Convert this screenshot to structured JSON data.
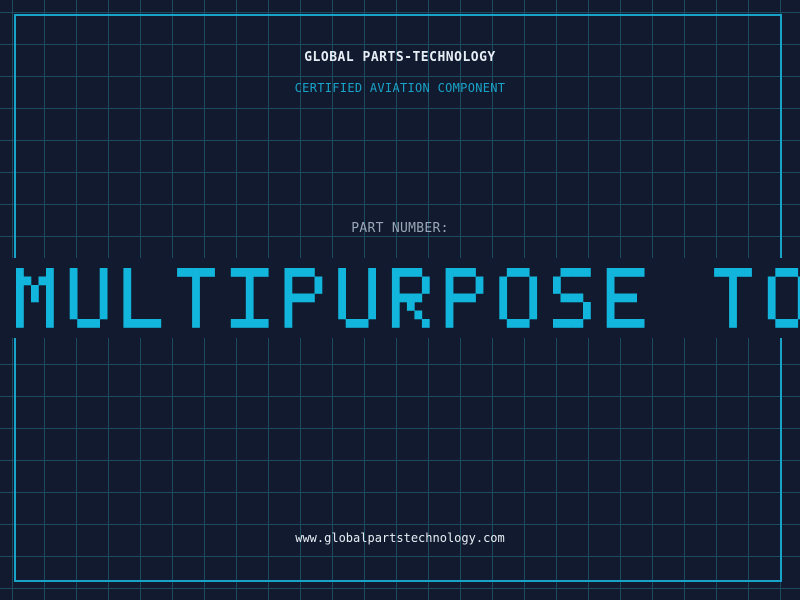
{
  "header": {
    "brand": "GLOBAL PARTS-TECHNOLOGY",
    "tagline": "CERTIFIED AVIATION COMPONENT"
  },
  "part": {
    "label": "PART NUMBER:",
    "name": "MULTIPURPOSE TOOL"
  },
  "footer": {
    "url": "www.globalpartstechnology.com"
  },
  "colors": {
    "background": "#111a2e",
    "grid": "#1d4a5e",
    "accent": "#1aa3c8",
    "title": "#12b5dc",
    "text": "#e8eef5",
    "muted": "#9aa7b8"
  }
}
